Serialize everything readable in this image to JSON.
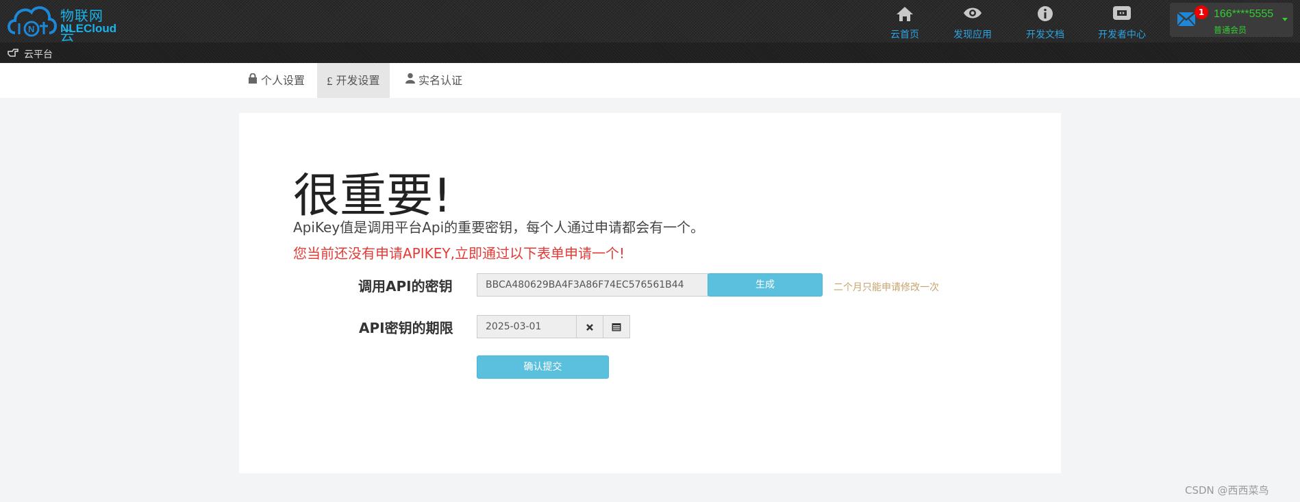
{
  "header": {
    "logo_cn": "物联网云",
    "logo_en": "NLECloud",
    "nav": [
      {
        "label": "云首页",
        "icon": "home-icon"
      },
      {
        "label": "发现应用",
        "icon": "eye-icon"
      },
      {
        "label": "开发文档",
        "icon": "info-icon"
      },
      {
        "label": "开发者中心",
        "icon": "developer-icon"
      }
    ],
    "user": {
      "badge_count": "1",
      "phone": "166****5555",
      "level": "普通会员"
    }
  },
  "breadcrumb": {
    "label": "云平台"
  },
  "tabs": [
    {
      "label": "个人设置",
      "icon": "lock-icon"
    },
    {
      "label": "开发设置",
      "icon": "pound-icon"
    },
    {
      "label": "实名认证",
      "icon": "user-icon"
    }
  ],
  "main": {
    "title": "很重要!",
    "description": "ApiKey值是调用平台Api的重要密钥，每个人通过申请都会有一个。",
    "warning": "您当前还没有申请APIKEY,立即通过以下表单申请一个!",
    "form": {
      "key_label": "调用API的密钥",
      "key_value": "BBCA480629BA4F3A86F74EC576561B44",
      "generate_label": "生成",
      "hint": "二个月只能申请修改一次",
      "expiry_label": "API密钥的期限",
      "expiry_value": "2025-03-01",
      "submit_label": "确认提交"
    }
  },
  "watermark": "CSDN @西西菜鸟",
  "colors": {
    "accent": "#5bc0de",
    "nav_text": "#2ea3e0",
    "warning": "#e53935",
    "user_green": "#33cc33",
    "hint": "#c8a36a"
  }
}
